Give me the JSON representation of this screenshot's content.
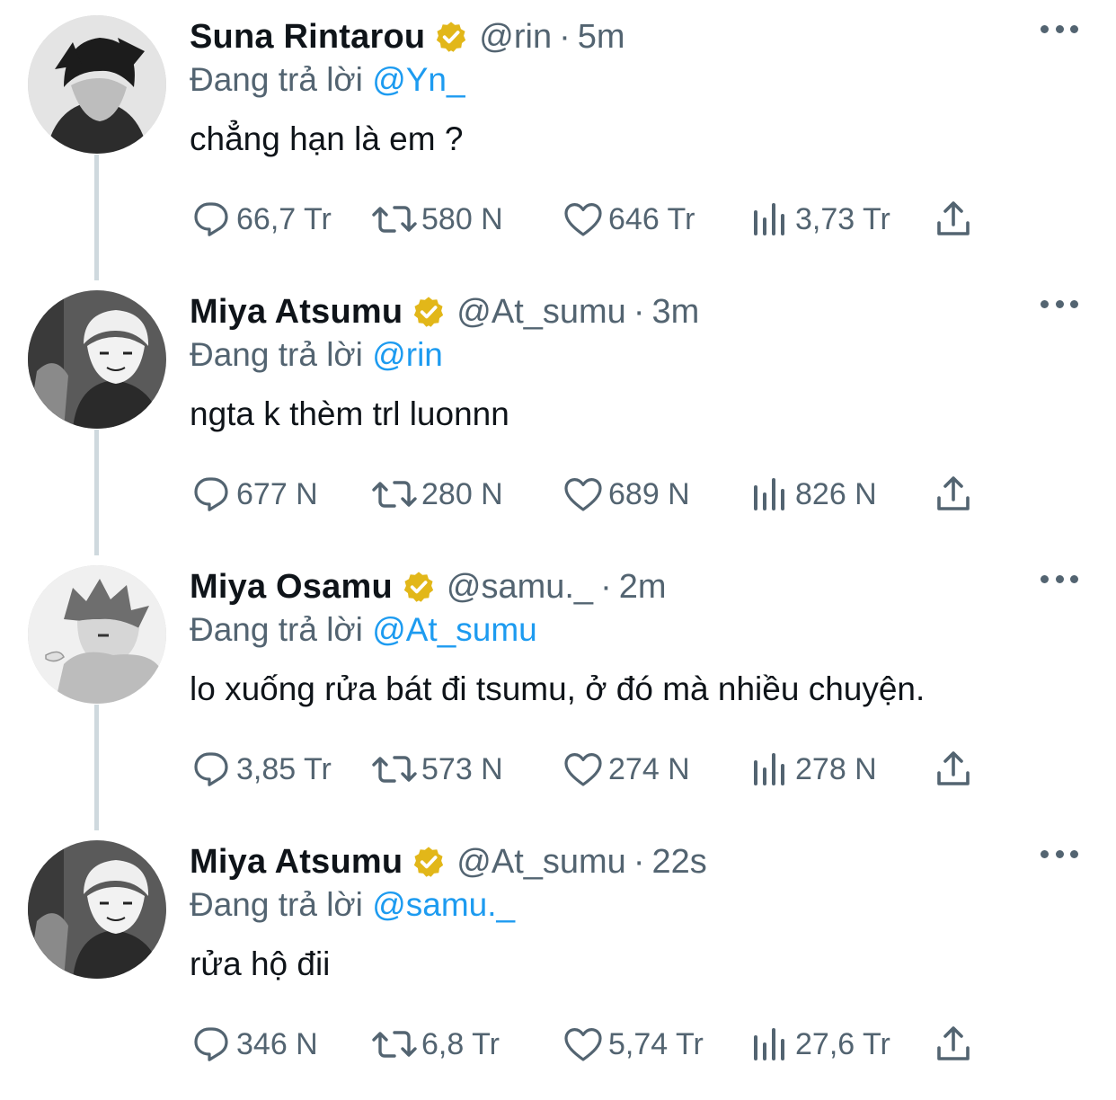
{
  "tweets": [
    {
      "name": "Suna Rintarou",
      "handle": "@rin",
      "time": "5m",
      "replying_prefix": "Đang trả lời",
      "replying_to": "@Yn_",
      "text": "chẳng hạn là em ?",
      "replies": "66,7 Tr",
      "retweets": "580 N",
      "likes": "646 Tr",
      "views": "3,73 Tr"
    },
    {
      "name": "Miya Atsumu",
      "handle": "@At_sumu",
      "time": "3m",
      "replying_prefix": "Đang trả lời",
      "replying_to": "@rin",
      "text": "ngta k thèm trl luonnn",
      "replies": "677 N",
      "retweets": "280 N",
      "likes": "689 N",
      "views": "826 N"
    },
    {
      "name": "Miya Osamu",
      "handle": "@samu._",
      "time": "2m",
      "replying_prefix": "Đang trả lời",
      "replying_to": "@At_sumu",
      "text": "lo xuống rửa bát đi tsumu, ở đó mà nhiều chuyện.",
      "replies": "3,85 Tr",
      "retweets": "573 N",
      "likes": "274 N",
      "views": "278 N"
    },
    {
      "name": "Miya Atsumu",
      "handle": "@At_sumu",
      "time": "22s",
      "replying_prefix": "Đang trả lời",
      "replying_to": "@samu._",
      "text": "rửa hộ đii",
      "replies": "346 N",
      "retweets": "6,8 Tr",
      "likes": "5,74 Tr",
      "views": "27,6 Tr"
    }
  ],
  "colors": {
    "text": "#0f1419",
    "secondary": "#536471",
    "link": "#1d9bf0",
    "badge": "#e2b719",
    "thread_line": "#cfd9de"
  },
  "icons": [
    "reply-icon",
    "retweet-icon",
    "like-icon",
    "views-icon",
    "share-icon",
    "more-icon",
    "verified-badge-icon"
  ]
}
